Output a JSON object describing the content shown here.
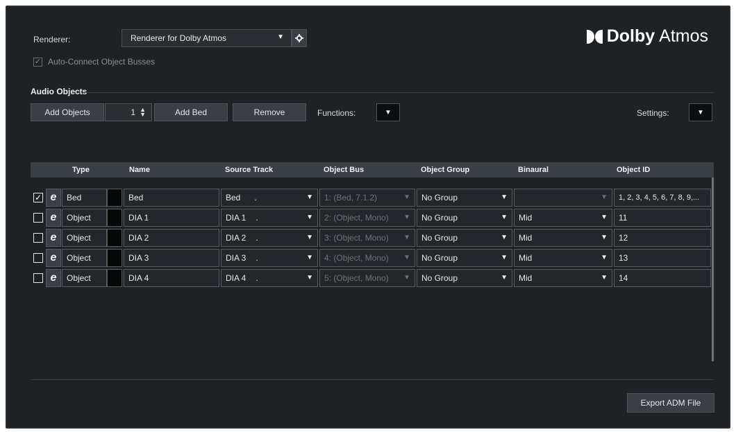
{
  "renderer": {
    "label": "Renderer:",
    "selected": "Renderer for Dolby Atmos",
    "auto_connect_label": "Auto-Connect Object Busses",
    "auto_connect_checked": true
  },
  "logo": {
    "word1": "Dolby",
    "word2": "Atmos"
  },
  "audio_objects": {
    "title": "Audio Objects",
    "add_objects_label": "Add Objects",
    "add_count": "1",
    "add_bed_label": "Add Bed",
    "remove_label": "Remove",
    "functions_label": "Functions:",
    "settings_label": "Settings:"
  },
  "table": {
    "headers": {
      "type": "Type",
      "name": "Name",
      "source_track": "Source Track",
      "object_bus": "Object Bus",
      "object_group": "Object Group",
      "binaural": "Binaural",
      "object_id": "Object ID"
    },
    "rows": [
      {
        "checked": true,
        "type": "Bed",
        "name": "Bed",
        "source_track": "Bed",
        "object_bus": "1: (Bed, 7.1.2)",
        "object_group": "No Group",
        "binaural": "",
        "object_id": "1, 2, 3, 4, 5, 6, 7, 8, 9,..."
      },
      {
        "checked": false,
        "type": "Object",
        "name": "DIA 1",
        "source_track": "DIA 1",
        "object_bus": "2: (Object, Mono)",
        "object_group": "No Group",
        "binaural": "Mid",
        "object_id": "11"
      },
      {
        "checked": false,
        "type": "Object",
        "name": "DIA 2",
        "source_track": "DIA 2",
        "object_bus": "3: (Object, Mono)",
        "object_group": "No Group",
        "binaural": "Mid",
        "object_id": "12"
      },
      {
        "checked": false,
        "type": "Object",
        "name": "DIA 3",
        "source_track": "DIA 3",
        "object_bus": "4: (Object, Mono)",
        "object_group": "No Group",
        "binaural": "Mid",
        "object_id": "13"
      },
      {
        "checked": false,
        "type": "Object",
        "name": "DIA 4",
        "source_track": "DIA 4",
        "object_bus": "5: (Object, Mono)",
        "object_group": "No Group",
        "binaural": "Mid",
        "object_id": "14"
      }
    ]
  },
  "export_label": "Export ADM File",
  "glyphs": {
    "arrow": "▼",
    "check": "✓",
    "edit": "e",
    "dot": "."
  }
}
